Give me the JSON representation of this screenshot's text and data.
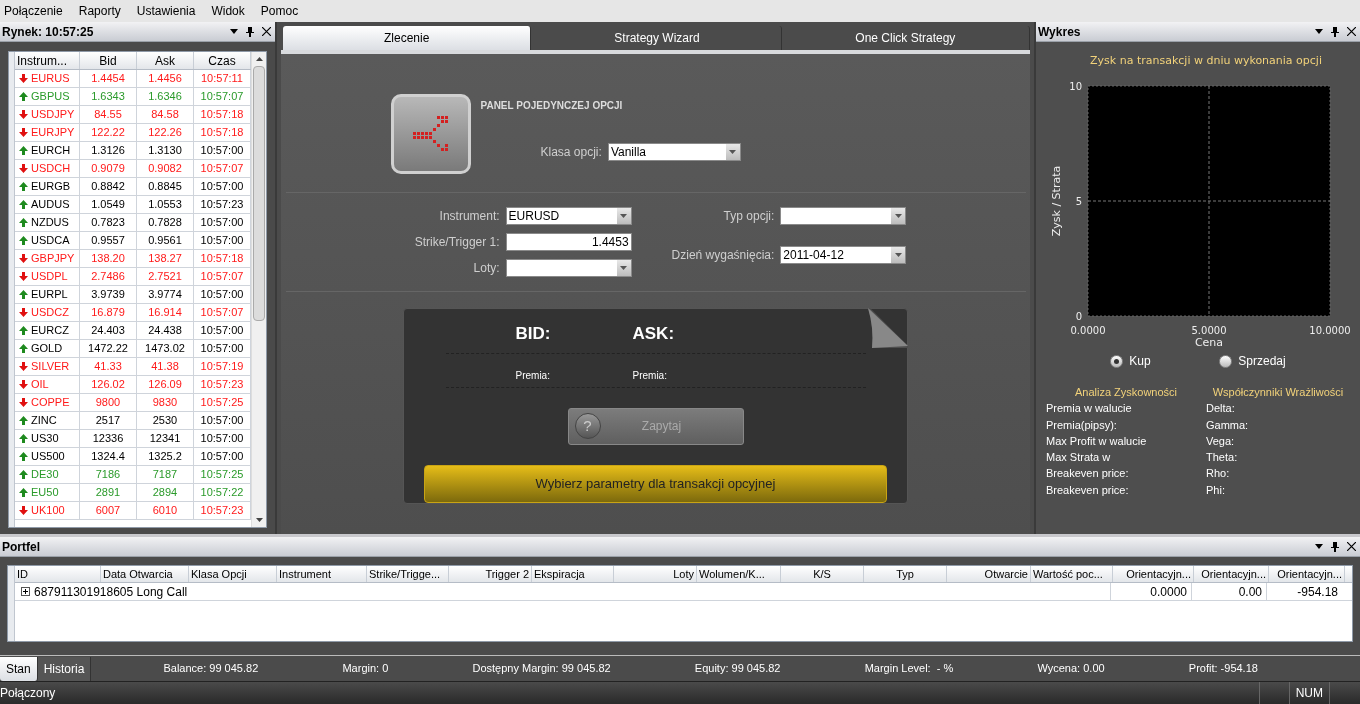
{
  "menu": [
    "Połączenie",
    "Raporty",
    "Ustawienia",
    "Widok",
    "Pomoc"
  ],
  "market": {
    "title": "Rynek: 10:57:25",
    "columns": [
      "Instrum...",
      "Bid",
      "Ask",
      "Czas"
    ],
    "rows": [
      {
        "instrument": "EURUS",
        "bid": "1.4454",
        "ask": "1.4456",
        "time": "10:57:11",
        "rising": false,
        "color": "#ff1a1a"
      },
      {
        "instrument": "GBPUS",
        "bid": "1.6343",
        "ask": "1.6346",
        "time": "10:57:07",
        "rising": true,
        "color": "#2a9a2a"
      },
      {
        "instrument": "USDJPY",
        "bid": "84.55",
        "ask": "84.58",
        "time": "10:57:18",
        "rising": false,
        "color": "#ff1a1a"
      },
      {
        "instrument": "EURJPY",
        "bid": "122.22",
        "ask": "122.26",
        "time": "10:57:18",
        "rising": false,
        "color": "#ff1a1a"
      },
      {
        "instrument": "EURCH",
        "bid": "1.3126",
        "ask": "1.3130",
        "time": "10:57:00",
        "rising": true,
        "color": "#000000"
      },
      {
        "instrument": "USDCH",
        "bid": "0.9079",
        "ask": "0.9082",
        "time": "10:57:07",
        "rising": false,
        "color": "#ff1a1a"
      },
      {
        "instrument": "EURGB",
        "bid": "0.8842",
        "ask": "0.8845",
        "time": "10:57:00",
        "rising": true,
        "color": "#000000"
      },
      {
        "instrument": "AUDUS",
        "bid": "1.0549",
        "ask": "1.0553",
        "time": "10:57:23",
        "rising": true,
        "color": "#000000"
      },
      {
        "instrument": "NZDUS",
        "bid": "0.7823",
        "ask": "0.7828",
        "time": "10:57:00",
        "rising": true,
        "color": "#000000"
      },
      {
        "instrument": "USDCA",
        "bid": "0.9557",
        "ask": "0.9561",
        "time": "10:57:00",
        "rising": true,
        "color": "#000000"
      },
      {
        "instrument": "GBPJPY",
        "bid": "138.20",
        "ask": "138.27",
        "time": "10:57:18",
        "rising": false,
        "color": "#ff1a1a"
      },
      {
        "instrument": "USDPL",
        "bid": "2.7486",
        "ask": "2.7521",
        "time": "10:57:07",
        "rising": false,
        "color": "#ff1a1a"
      },
      {
        "instrument": "EURPL",
        "bid": "3.9739",
        "ask": "3.9774",
        "time": "10:57:00",
        "rising": true,
        "color": "#000000"
      },
      {
        "instrument": "USDCZ",
        "bid": "16.879",
        "ask": "16.914",
        "time": "10:57:07",
        "rising": false,
        "color": "#ff1a1a"
      },
      {
        "instrument": "EURCZ",
        "bid": "24.403",
        "ask": "24.438",
        "time": "10:57:00",
        "rising": true,
        "color": "#000000"
      },
      {
        "instrument": "GOLD",
        "bid": "1472.22",
        "ask": "1473.02",
        "time": "10:57:00",
        "rising": true,
        "color": "#000000"
      },
      {
        "instrument": "SILVER",
        "bid": "41.33",
        "ask": "41.38",
        "time": "10:57:19",
        "rising": false,
        "color": "#ff1a1a"
      },
      {
        "instrument": "OIL",
        "bid": "126.02",
        "ask": "126.09",
        "time": "10:57:23",
        "rising": false,
        "color": "#ff1a1a"
      },
      {
        "instrument": "COPPE",
        "bid": "9800",
        "ask": "9830",
        "time": "10:57:25",
        "rising": false,
        "color": "#ff1a1a"
      },
      {
        "instrument": "ZINC",
        "bid": "2517",
        "ask": "2530",
        "time": "10:57:00",
        "rising": true,
        "color": "#000000"
      },
      {
        "instrument": "US30",
        "bid": "12336",
        "ask": "12341",
        "time": "10:57:00",
        "rising": true,
        "color": "#000000"
      },
      {
        "instrument": "US500",
        "bid": "1324.4",
        "ask": "1325.2",
        "time": "10:57:00",
        "rising": true,
        "color": "#000000"
      },
      {
        "instrument": "DE30",
        "bid": "7186",
        "ask": "7187",
        "time": "10:57:25",
        "rising": true,
        "color": "#2a9a2a"
      },
      {
        "instrument": "EU50",
        "bid": "2891",
        "ask": "2894",
        "time": "10:57:22",
        "rising": true,
        "color": "#2a9a2a"
      },
      {
        "instrument": "UK100",
        "bid": "6007",
        "ask": "6010",
        "time": "10:57:23",
        "rising": false,
        "color": "#ff1a1a"
      }
    ]
  },
  "tabs": [
    {
      "label": "Zlecenie",
      "selected": true
    },
    {
      "label": "Strategy Wizard",
      "selected": false
    },
    {
      "label": "One Click Strategy",
      "selected": false
    }
  ],
  "order": {
    "heading": "PANEL POJEDYNCZEJ OPCJI",
    "option_class": {
      "label": "Klasa opcji:",
      "value": "Vanilla"
    },
    "instrument": {
      "label": "Instrument:",
      "value": "EURUSD"
    },
    "strike": {
      "label": "Strike/Trigger 1:",
      "value": "1.4453"
    },
    "lots": {
      "label": "Loty:"
    },
    "option_type": {
      "label": "Typ opcji:"
    },
    "expiry": {
      "label": "Dzień wygaśnięcia:",
      "value": "2011-04-12"
    },
    "bid": "BID:",
    "ask": "ASK:",
    "bid_premium": "Premia:",
    "ask_premium": "Premia:",
    "ask_button": {
      "icon": "?",
      "label": "Zapytaj",
      "disabled": true
    },
    "action_button": "Wybierz parametry dla transakcji opcyjnej"
  },
  "chart_panel": {
    "title": "Wykres",
    "chart_data": {
      "type": "line",
      "title": "Zysk na transakcji w dniu wykonania opcji",
      "xlabel": "Cena",
      "ylabel": "Zysk / Strata",
      "xlim": [
        0,
        10
      ],
      "ylim": [
        0,
        10
      ],
      "xticks": [
        {
          "value": 0,
          "label": "0.0000"
        },
        {
          "value": 5,
          "label": "5.0000"
        },
        {
          "value": 10,
          "label": "10.0000"
        }
      ],
      "yticks": [
        0,
        5,
        10
      ]
    },
    "sides": [
      {
        "label": "Kup",
        "selected": true
      },
      {
        "label": "Sprzedaj",
        "selected": false
      }
    ],
    "analysis": {
      "title": "Analiza Zyskowności",
      "items": [
        "Premia w walucie",
        "Premia(pipsy):",
        "Max Profit w walucie",
        "Max Strata w",
        "Breakeven price:",
        "Breakeven price:"
      ]
    },
    "greeks": {
      "title": "Współczynniki Wrażliwości",
      "items": [
        "Delta:",
        "Gamma:",
        "Vega:",
        "Theta:",
        "Rho:",
        "Phi:"
      ]
    }
  },
  "portfolio": {
    "title": "Portfel",
    "columns": [
      "ID",
      "Data Otwarcia",
      "Klasa Opcji",
      "Instrument",
      "Strike/Trigge...",
      "Trigger 2",
      "Ekspiracja",
      "Loty",
      "Wolumen/K...",
      "K/S",
      "Typ",
      "Otwarcie",
      "Wartość poc...",
      "Orientacyjn...",
      "Orientacyjn...",
      "Orientacyjn..."
    ],
    "group": {
      "label": "687911301918605 Long Call",
      "expanded": false,
      "values": [
        "0.0000",
        "0.00",
        "-954.18"
      ]
    }
  },
  "bottom_tabs": [
    {
      "label": "Stan",
      "selected": true
    },
    {
      "label": "Historia",
      "selected": false
    }
  ],
  "summary": [
    "Balance: 99 045.82",
    "Margin: 0",
    "Dostępny Margin: 99 045.82",
    "Equity: 99 045.82",
    "Margin Level:  - %",
    "Wycena: 0.00",
    "Profit: -954.18"
  ],
  "status": {
    "text": "Połączony",
    "indicator": "NUM"
  }
}
